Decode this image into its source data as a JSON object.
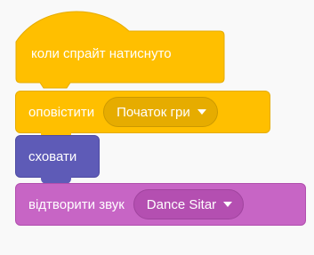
{
  "blocks": {
    "when_sprite_clicked": {
      "label": "коли спрайт натиснуто"
    },
    "broadcast": {
      "label": "оповістити",
      "message": "Початок гри"
    },
    "hide": {
      "label": "сховати"
    },
    "play_sound": {
      "label": "відтворити звук",
      "sound": "Dance Sitar"
    }
  },
  "colors": {
    "events": "#ffbf00",
    "looks": "#5e5bb7",
    "sound": "#c765c5",
    "background": "#f9f9f9"
  },
  "icons": {
    "dropdown": "chevron-down-icon"
  }
}
